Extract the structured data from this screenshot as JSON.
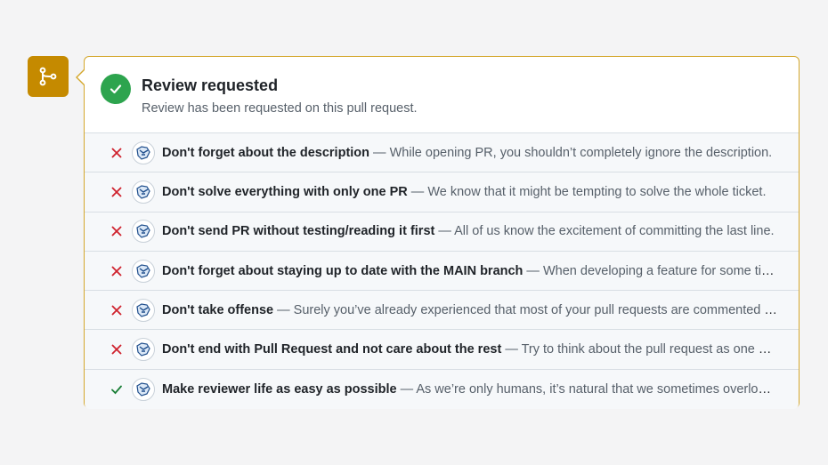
{
  "badge": {
    "icon": "git-branch-icon",
    "color": "#c58a00"
  },
  "header": {
    "icon": "check-circle-icon",
    "title": "Review requested",
    "subtitle": "Review has been requested on this pull request."
  },
  "separator": "—",
  "checks": [
    {
      "status": "fail",
      "title": "Don't forget about the description",
      "description": "While opening PR, you shouldn’t completely ignore the description."
    },
    {
      "status": "fail",
      "title": "Don't solve everything with only one PR",
      "description": "We know that it might be tempting to solve the whole ticket."
    },
    {
      "status": "fail",
      "title": "Don't send PR without testing/reading it first",
      "description": "All of us know the excitement of committing the last line."
    },
    {
      "status": "fail",
      "title": "Don't forget about staying up to date with the MAIN branch",
      "description": "When developing a feature for some time."
    },
    {
      "status": "fail",
      "title": "Don't take offense",
      "description": "Surely you’ve already experienced that most of your pull requests are commented on."
    },
    {
      "status": "fail",
      "title": "Don't end with Pull Request and not care about the rest",
      "description": "Try to think about the pull request as one part of the process."
    },
    {
      "status": "pass",
      "title": "Make reviewer life as easy as possible",
      "description": "As we’re only humans, it’s natural that we sometimes overlook things."
    }
  ],
  "colors": {
    "fail": "#cf222e",
    "pass": "#1a7f37",
    "border": "#d4a72c"
  }
}
